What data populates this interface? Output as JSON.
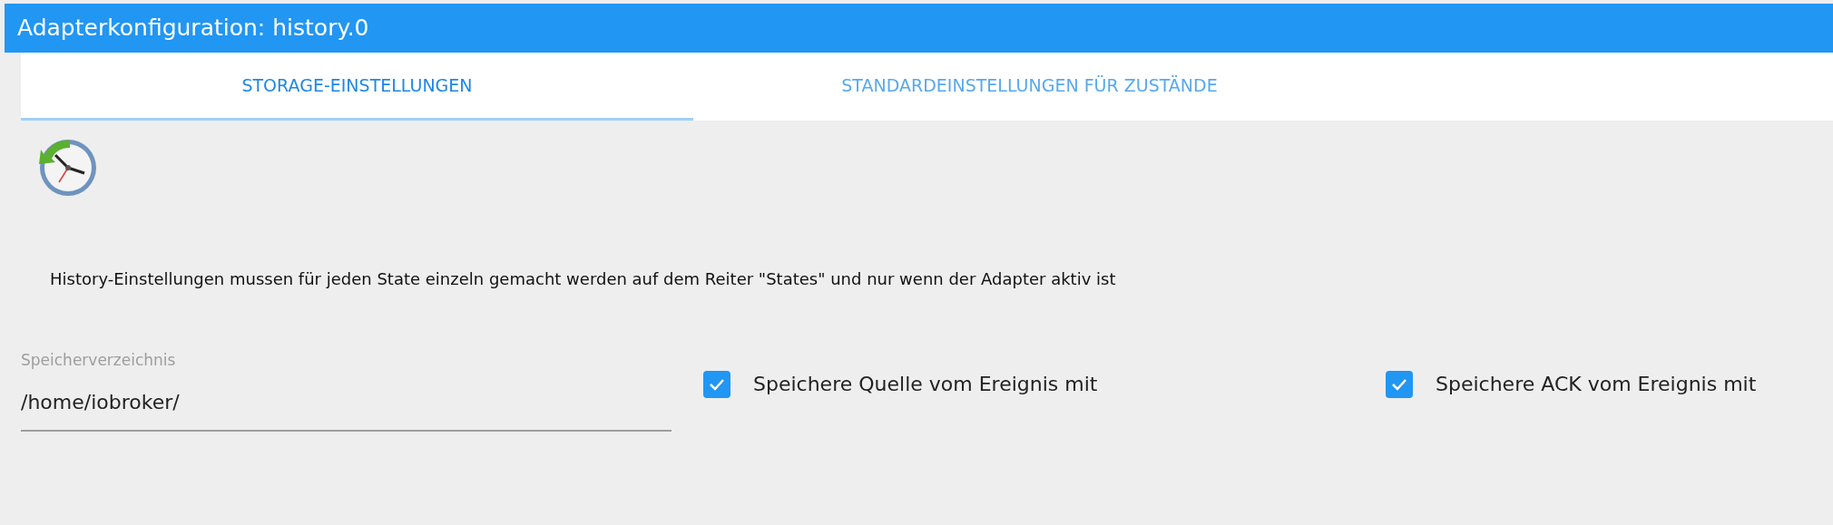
{
  "window": {
    "title": "Adapterkonfiguration: history.0"
  },
  "tabs": [
    {
      "label": "STORAGE-EINSTELLUNGEN",
      "selected": true
    },
    {
      "label": "STANDARDEINSTELLUNGEN FÜR ZUSTÄNDE",
      "selected": false
    }
  ],
  "info_text": "History-Einstellungen mussen für jeden State einzeln gemacht werden auf dem Reiter \"States\" und nur wenn der Adapter aktiv ist",
  "storage_dir": {
    "label": "Speicherverzeichnis",
    "value": "/home/iobroker/"
  },
  "checkboxes": [
    {
      "label": "Speichere Quelle vom Ereignis mit",
      "checked": true
    },
    {
      "label": "Speichere ACK vom Ereignis mit",
      "checked": true
    }
  ]
}
